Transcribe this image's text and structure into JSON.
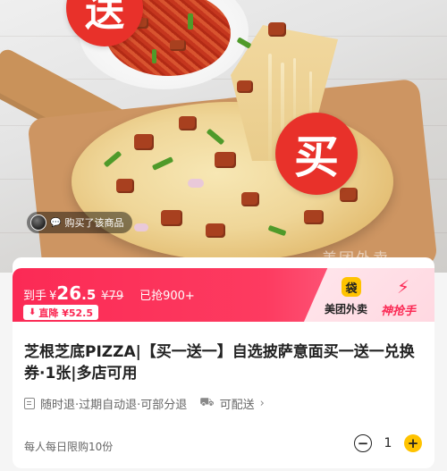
{
  "hero": {
    "badge_left": "送",
    "badge_right": "买",
    "buyer_tag": "购买了该商品",
    "watermark": "美团外卖"
  },
  "price": {
    "prefix": "到手",
    "currency": "¥",
    "integer": "26",
    "decimal": ".5",
    "original": "¥79",
    "sold": "已抢900+",
    "drop_label": "直降 ¥52.5"
  },
  "brand": {
    "meituan_name": "美团外卖",
    "shenqiang_name": "神抢手",
    "meituan_icon": "kangaroo-logo-icon",
    "shenqiang_icon": "bolt-logo-icon"
  },
  "product": {
    "title": "芝根芝底PIZZA|【买一送一】自选披萨意面买一送一兑换券·1张|多店可用"
  },
  "service": {
    "refund_text": "随时退·过期自动退·可部分退",
    "delivery_text": "可配送"
  },
  "purchase": {
    "limit_text": "每人每日限购10份",
    "quantity": "1",
    "minus": "−",
    "plus": "+"
  },
  "colors": {
    "accent": "#fb2a55",
    "badge_red": "#e8312a",
    "yellow": "#ffc300"
  }
}
